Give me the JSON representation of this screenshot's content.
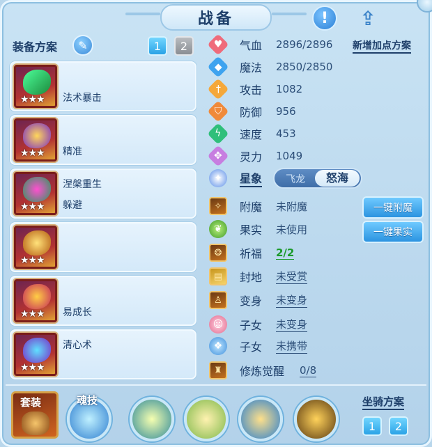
{
  "header": {
    "title": "战备"
  },
  "equipment": {
    "title": "装备方案",
    "plans": [
      "1",
      "2"
    ],
    "slots": [
      {
        "line1": "法术暴击",
        "line2": "",
        "stars": "★★★"
      },
      {
        "line1": "精准",
        "line2": "",
        "stars": "★★★"
      },
      {
        "line1": "涅槃重生",
        "line2": "躲避",
        "stars": "★★★"
      },
      {
        "line1": "",
        "line2": "",
        "stars": "★★★"
      },
      {
        "line1": "易成长",
        "line2": "",
        "stars": "★★★"
      },
      {
        "line1": "清心术",
        "line2": "",
        "stars": "★★★"
      }
    ]
  },
  "stats": {
    "new_plan": "新增加点方案",
    "rows": [
      {
        "label": "气血",
        "value": "2896/2896",
        "icon": "heart-icon",
        "color": "#ef6b7b"
      },
      {
        "label": "魔法",
        "value": "2850/2850",
        "icon": "mana-icon",
        "color": "#3ea3ef"
      },
      {
        "label": "攻击",
        "value": "1082",
        "icon": "sword-icon",
        "color": "#f5a83a"
      },
      {
        "label": "防御",
        "value": "956",
        "icon": "shield-icon",
        "color": "#f08a3a"
      },
      {
        "label": "速度",
        "value": "453",
        "icon": "speed-icon",
        "color": "#2fbf7a"
      },
      {
        "label": "灵力",
        "value": "1049",
        "icon": "spirit-icon",
        "color": "#c77ee0"
      }
    ]
  },
  "constellation": {
    "label": "星象",
    "option_off": "飞龙",
    "option_on": "怒海"
  },
  "attributes": [
    {
      "label": "附魔",
      "value": "未附魔",
      "style": "plain",
      "icon": "enchant-icon"
    },
    {
      "label": "果实",
      "value": "未使用",
      "style": "plain",
      "icon": "fruit-icon"
    },
    {
      "label": "祈福",
      "value": "2/2",
      "style": "green",
      "icon": "blessing-icon"
    },
    {
      "label": "封地",
      "value": "未受赏",
      "style": "underline",
      "icon": "fief-icon"
    },
    {
      "label": "变身",
      "value": "未变身",
      "style": "underline",
      "icon": "transform-icon"
    },
    {
      "label": "子女",
      "value": "未变身",
      "style": "underline",
      "icon": "child-icon"
    },
    {
      "label": "子女",
      "value": "未携带",
      "style": "underline",
      "icon": "paw-icon"
    },
    {
      "label": "修炼觉醒",
      "value": "0/8",
      "style": "underline",
      "icon": "cultivation-icon"
    }
  ],
  "actions": {
    "enchant": "一键附魔",
    "fruit": "一键果实"
  },
  "bottom": {
    "suit": "套装",
    "soul_skill": "魂技",
    "mount_title": "坐骑方案",
    "mount_plans": [
      "1",
      "2"
    ]
  }
}
